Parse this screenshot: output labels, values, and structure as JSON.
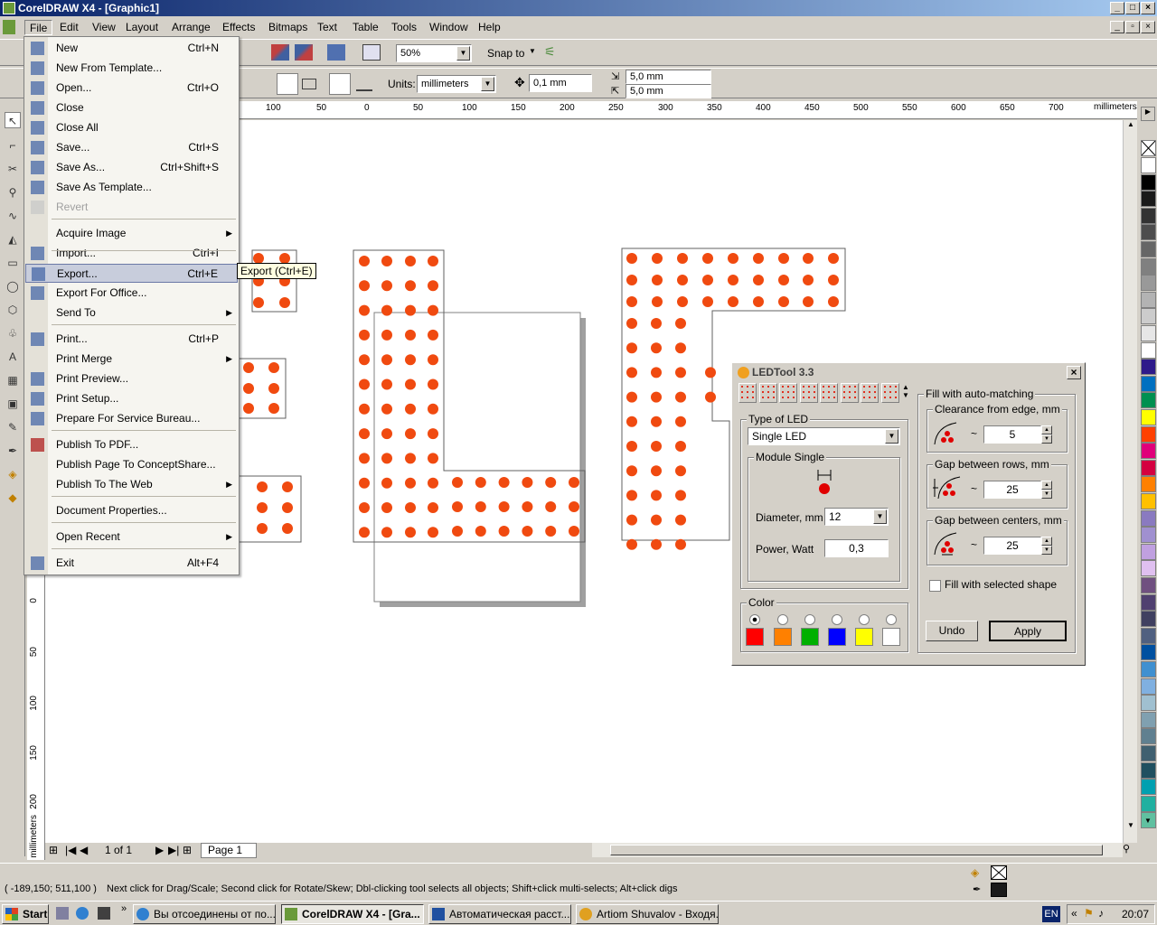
{
  "window": {
    "title": "CorelDRAW X4 - [Graphic1]"
  },
  "menubar": [
    "File",
    "Edit",
    "View",
    "Layout",
    "Arrange",
    "Effects",
    "Bitmaps",
    "Text",
    "Table",
    "Tools",
    "Window",
    "Help"
  ],
  "toolbar": {
    "zoom": "50%",
    "snap_to": "Snap to"
  },
  "propbar": {
    "units_label": "Units:",
    "units_value": "millimeters",
    "nudge": "0,1 mm",
    "dup_x": "5,0 mm",
    "dup_y": "5,0 mm"
  },
  "rulers": {
    "h_ticks": [
      "100",
      "50",
      "0",
      "50",
      "100",
      "150",
      "200",
      "250",
      "300",
      "350",
      "400",
      "450",
      "500",
      "550",
      "600",
      "650",
      "700"
    ],
    "h_unit": "millimeters",
    "v_ticks": [
      "0",
      "50",
      "100",
      "150",
      "200"
    ],
    "v_unit": "millimeters"
  },
  "file_menu": {
    "items": [
      {
        "label": "New",
        "shortcut": "Ctrl+N"
      },
      {
        "label": "New From Template...",
        "shortcut": ""
      },
      {
        "label": "Open...",
        "shortcut": "Ctrl+O"
      },
      {
        "label": "Close",
        "shortcut": ""
      },
      {
        "label": "Close All",
        "shortcut": ""
      },
      {
        "label": "Save...",
        "shortcut": "Ctrl+S"
      },
      {
        "label": "Save As...",
        "shortcut": "Ctrl+Shift+S"
      },
      {
        "label": "Save As Template...",
        "shortcut": ""
      },
      {
        "label": "Revert",
        "shortcut": ""
      },
      {
        "label": "Acquire Image",
        "shortcut": ""
      },
      {
        "label": "Import...",
        "shortcut": "Ctrl+I"
      },
      {
        "label": "Export...",
        "shortcut": "Ctrl+E"
      },
      {
        "label": "Export For Office...",
        "shortcut": ""
      },
      {
        "label": "Send To",
        "shortcut": ""
      },
      {
        "label": "Print...",
        "shortcut": "Ctrl+P"
      },
      {
        "label": "Print Merge",
        "shortcut": ""
      },
      {
        "label": "Print Preview...",
        "shortcut": ""
      },
      {
        "label": "Print Setup...",
        "shortcut": ""
      },
      {
        "label": "Prepare For Service Bureau...",
        "shortcut": ""
      },
      {
        "label": "Publish To PDF...",
        "shortcut": ""
      },
      {
        "label": "Publish Page To ConceptShare...",
        "shortcut": ""
      },
      {
        "label": "Publish To The Web",
        "shortcut": ""
      },
      {
        "label": "Document Properties...",
        "shortcut": ""
      },
      {
        "label": "Open Recent",
        "shortcut": ""
      },
      {
        "label": "Exit",
        "shortcut": "Alt+F4"
      }
    ],
    "tooltip": "Export (Ctrl+E)"
  },
  "led_dialog": {
    "title": "LEDTool 3.3",
    "type_group": "Type of LED",
    "type_value": "Single LED",
    "module_group": "Module Single",
    "diameter_label": "Diameter, mm",
    "diameter_value": "12",
    "power_label": "Power, Watt",
    "power_value": "0,3",
    "color_group": "Color",
    "colors": [
      "#ff0000",
      "#ff8000",
      "#00b000",
      "#0000ff",
      "#ffff00",
      "#ffffff"
    ],
    "fill_group": "Fill with auto-matching",
    "clearance_label": "Clearance from edge, mm",
    "clearance_value": "5",
    "rows_label": "Gap between rows, mm",
    "rows_value": "25",
    "centers_label": "Gap between centers, mm",
    "centers_value": "25",
    "fill_selected_label": "Fill with selected shape",
    "undo_label": "Undo",
    "apply_label": "Apply"
  },
  "page_nav": {
    "page_count": "1 of 1",
    "page_tab": "Page 1"
  },
  "status": {
    "coords": "( -189,150; 511,100 )",
    "hint": "Next click for Drag/Scale; Second click for Rotate/Skew; Dbl-clicking tool selects all objects; Shift+click multi-selects; Alt+click digs"
  },
  "taskbar": {
    "start": "Start",
    "tasks": [
      "Вы отсоединены от по...",
      "CorelDRAW X4 - [Gra...",
      "Автоматическая расст...",
      "Artiom Shuvalov - Входя..."
    ],
    "lang": "EN",
    "clock": "20:07"
  },
  "palette": [
    "#ffffff",
    "#000000",
    "#1a1a1a",
    "#333333",
    "#4d4d4d",
    "#666666",
    "#808080",
    "#999999",
    "#b3b3b3",
    "#cccccc",
    "#e6e6e6",
    "#ffffff",
    "#2e1a8a",
    "#0070c0",
    "#009050",
    "#ffff00",
    "#ff4000",
    "#e0007a",
    "#d40040",
    "#ff8000",
    "#ffc000",
    "#8a7ac0",
    "#a090d0",
    "#c0a0e0",
    "#e0c0f0",
    "#705080",
    "#504070",
    "#404060",
    "#506080",
    "#0050a0",
    "#4090d0",
    "#80b0e0",
    "#a0c0d0",
    "#80a0b0",
    "#608090",
    "#406070",
    "#205060",
    "#00a0b0",
    "#20b0a0",
    "#60c0a0"
  ]
}
